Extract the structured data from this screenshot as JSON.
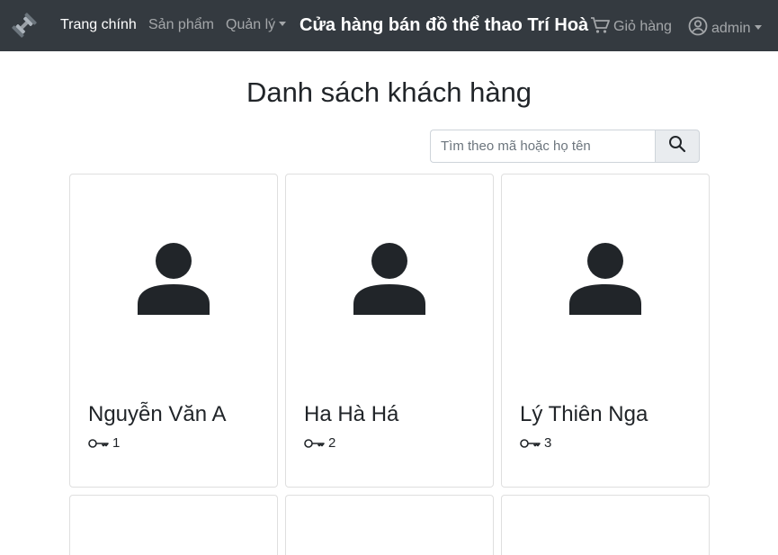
{
  "navbar": {
    "home_label": "Trang chính",
    "products_label": "Sản phẩm",
    "manage_label": "Quản lý",
    "shop_title": "Cửa hàng bán đồ thể thao Trí Hoà",
    "cart_label": "Giỏ hàng",
    "user_label": "admin"
  },
  "main": {
    "heading": "Danh sách khách hàng",
    "search": {
      "placeholder": "Tìm theo mã hoặc họ tên",
      "value": ""
    }
  },
  "customers": [
    {
      "name": "Nguyễn Văn A",
      "id": "1"
    },
    {
      "name": "Ha Hà Há",
      "id": "2"
    },
    {
      "name": "Lý Thiên Nga",
      "id": "3"
    }
  ],
  "colors": {
    "navbar_bg": "#343a40",
    "icon_dark": "#212529",
    "card_border": "#dfdfdf"
  },
  "icons": [
    "dumbbell-icon",
    "cart-icon",
    "user-circle-icon",
    "search-icon",
    "person-icon",
    "key-icon"
  ]
}
